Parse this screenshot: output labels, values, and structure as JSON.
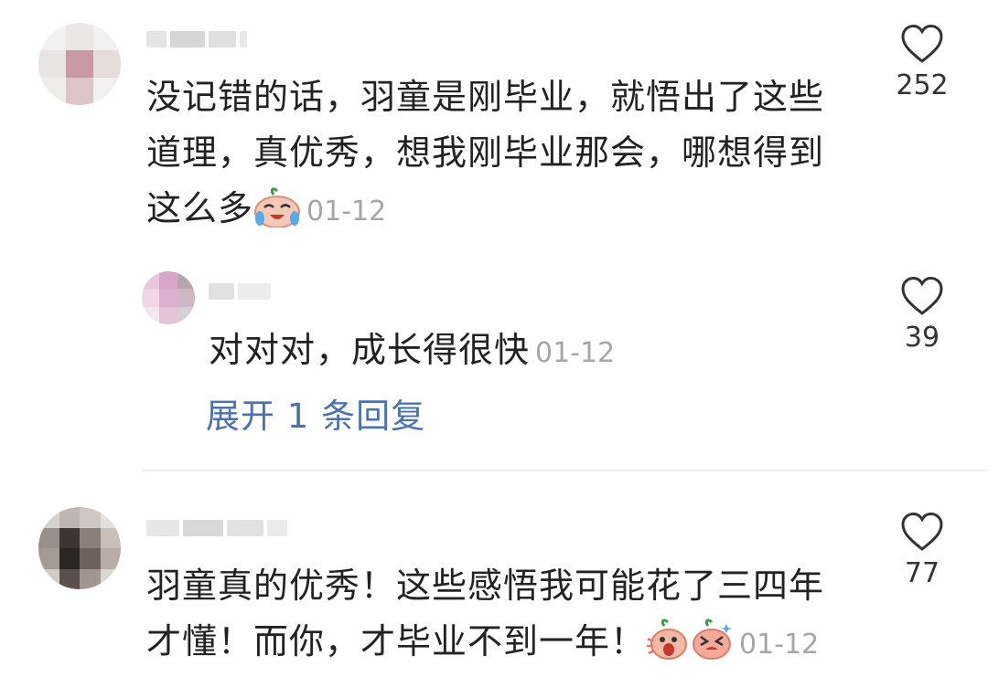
{
  "comments": [
    {
      "username": "",
      "text": "没记错的话，羽童是刚毕业，就悟出了这些道理，真优秀，想我刚毕业那会，哪想得到这么多",
      "emoji": [
        "crying-laughing-emoji"
      ],
      "time": "01-12",
      "like_count": "252",
      "replies": [
        {
          "username": "",
          "text": "对对对，成长得很快",
          "time": "01-12",
          "like_count": "39"
        }
      ],
      "expand_label": "展开 1 条回复"
    },
    {
      "username": "",
      "text": "羽童真的优秀！这些感悟我可能花了三四年才懂！而你，才毕业不到一年！",
      "emoji": [
        "shouting-emoji",
        "crying-emoji"
      ],
      "time": "01-12",
      "like_count": "77"
    }
  ],
  "colors": {
    "text": "#222222",
    "time": "#a6a6a6",
    "link": "#4a72b0",
    "divider": "#efefef"
  }
}
